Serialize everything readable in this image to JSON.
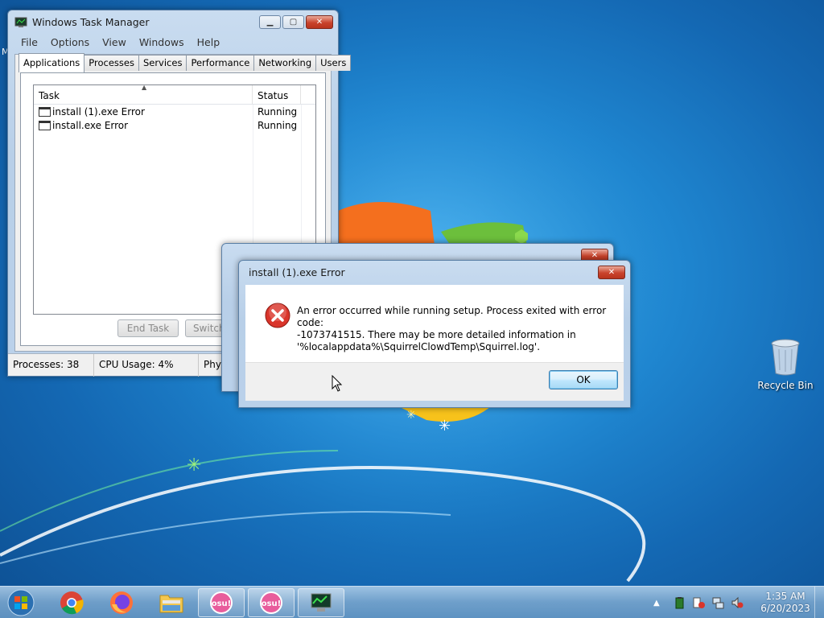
{
  "desktop": {
    "icons": [
      {
        "label": "Recycle Bin",
        "icon": "recycle-bin-icon"
      }
    ],
    "edge_text": "M"
  },
  "task_manager": {
    "title": "Windows Task Manager",
    "menu": [
      "File",
      "Options",
      "View",
      "Windows",
      "Help"
    ],
    "tabs": [
      "Applications",
      "Processes",
      "Services",
      "Performance",
      "Networking",
      "Users"
    ],
    "active_tab": "Applications",
    "columns": {
      "task": "Task",
      "status": "Status"
    },
    "rows": [
      {
        "task": "install (1).exe Error",
        "status": "Running"
      },
      {
        "task": "install.exe Error",
        "status": "Running"
      }
    ],
    "buttons": {
      "end_task": "End Task",
      "switch_to": "Switch To"
    },
    "status": {
      "processes": "Processes: 38",
      "cpu": "CPU Usage: 4%",
      "memory": "Physica"
    }
  },
  "error_dialog": {
    "title": "install (1).exe Error",
    "message_line1": "An error occurred while running setup. Process exited with error code:",
    "message_line2": "-1073741515. There may be more detailed information in",
    "message_line3": "'%localappdata%\\SquirrelClowdTemp\\Squirrel.log'.",
    "ok_label": "OK",
    "icon": "error-icon"
  },
  "taskbar": {
    "items": [
      "start-orb-icon",
      "chrome-icon",
      "firefox-icon",
      "file-explorer-icon",
      "osu-icon",
      "osu-icon",
      "task-manager-icon"
    ],
    "clock_time": "1:35 AM",
    "clock_date": "6/20/2023"
  },
  "colors": {
    "desktop_blue": "#1f86d0",
    "taskbar": "#7aa5cd",
    "close_red": "#c9432c",
    "error_red": "#d9352b",
    "osu_pink": "#e85d9c"
  }
}
